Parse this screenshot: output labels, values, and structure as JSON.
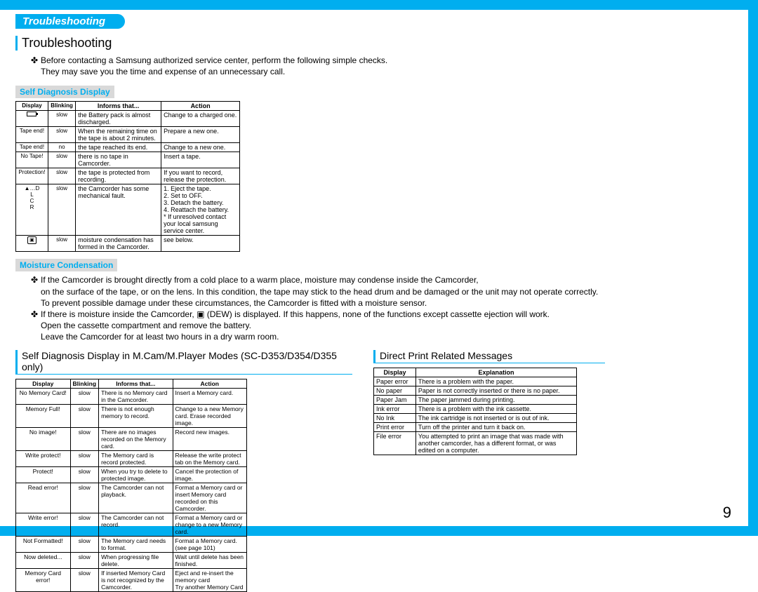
{
  "tab": "Troubleshooting",
  "h1": "Troubleshooting",
  "intro1": "Before contacting a Samsung authorized service center, perform the following simple checks.",
  "intro2": "They may save you the time and expense of an unnecessary call.",
  "sub1": "Self Diagnosis Display",
  "t1": {
    "head": [
      "Display",
      "Blinking",
      "Informs that...",
      "Action"
    ],
    "rows": [
      [
        "__BATT__",
        "slow",
        "the Battery pack is almost discharged.",
        "Change to a charged one."
      ],
      [
        "Tape end!",
        "slow",
        "When the remaining time on the tape is about 2 minutes.",
        "Prepare a new one."
      ],
      [
        "Tape end!",
        "no",
        "the tape reached its end.",
        "Change to a new one."
      ],
      [
        "No Tape!",
        "slow",
        "there is no tape in Camcorder.",
        "Insert a tape."
      ],
      [
        "Protection!",
        "slow",
        "the tape is protected from recording.",
        "If you want to record, release the protection."
      ],
      [
        "▲…D\nL\nC\nR",
        "slow",
        "the Camcorder has some mechanical fault.",
        "1. Eject the tape.\n2. Set to OFF.\n3. Detach the battery.\n4. Reattach the battery.\n* If unresolved contact your local samsung service center."
      ],
      [
        "__DEW__",
        "slow",
        "moisture condensation has formed in the Camcorder.",
        "see below."
      ]
    ]
  },
  "sub2": "Moisture Condensation",
  "mc": [
    "If the Camcorder is brought directly from a cold place to a warm place, moisture may condense inside the Camcorder,",
    "on the surface of the tape, or on the lens. In this condition, the tape may stick to the head drum and be damaged or the unit may not operate correctly.",
    "To prevent possible damage under these circumstances, the Camcorder is fitted with a moisture sensor.",
    "If there is moisture inside the Camcorder, ▣ (DEW) is displayed. If this happens, none of the functions except cassette ejection will work.",
    "Open the cassette compartment and remove the battery.",
    "Leave the Camcorder for at least two hours in a dry warm room."
  ],
  "sec2title": "Self Diagnosis Display in M.Cam/M.Player Modes (SC-D353/D354/D355 only)",
  "t2": {
    "head": [
      "Display",
      "Blinking",
      "Informs that...",
      "Action"
    ],
    "rows": [
      [
        "No Memory Card!",
        "slow",
        "There is no Memory card in the Camcorder.",
        "Insert a Memory card."
      ],
      [
        "Memory Full!",
        "slow",
        "There is not enough memory to record.",
        "Change to a new Memory card. Erase recorded image."
      ],
      [
        "No image!",
        "slow",
        "There are no images recorded on the Memory card.",
        "Record new images."
      ],
      [
        "Write protect!",
        "slow",
        "The Memory card is record protected.",
        "Release the write protect tab on the Memory card."
      ],
      [
        "Protect!",
        "slow",
        "When you try to delete to protected image.",
        "Cancel the protection of image."
      ],
      [
        "Read error!",
        "slow",
        "The Camcorder can not playback.",
        "Format a Memory card or insert Memory card recorded on this Camcorder."
      ],
      [
        "Write error!",
        "slow",
        "The Camcorder can not record.",
        "Format a Memory card or change to a new Memory card."
      ],
      [
        "Not Formatted!",
        "slow",
        "The Memory card needs to format.",
        "Format a Memory card. (see page 101)"
      ],
      [
        "Now deleted...",
        "slow",
        "When progressing file delete.",
        "Wait until delete has been finished."
      ],
      [
        "Memory Card error!",
        "slow",
        "If inserted Memory Card is not recognized by the Camcorder.",
        "Eject and re-insert the memory card\nTry another Memory Card"
      ]
    ]
  },
  "sec3title": "Direct Print Related Messages",
  "t3": {
    "head": [
      "Display",
      "Explanation"
    ],
    "rows": [
      [
        "Paper error",
        "There is a problem with the paper."
      ],
      [
        "No paper",
        "Paper is not correctly inserted or there is no paper."
      ],
      [
        "Paper Jam",
        "The paper jammed during printing."
      ],
      [
        "Ink error",
        "There is a problem with the ink cassette."
      ],
      [
        "No Ink",
        "The ink cartridge is not inserted or is out of ink."
      ],
      [
        "Print error",
        "Turn off the printer and turn it back on."
      ],
      [
        "File error",
        "You attempted to print an image that was made with another camcorder, has a different format, or was edited on a computer."
      ]
    ]
  },
  "page": "9"
}
